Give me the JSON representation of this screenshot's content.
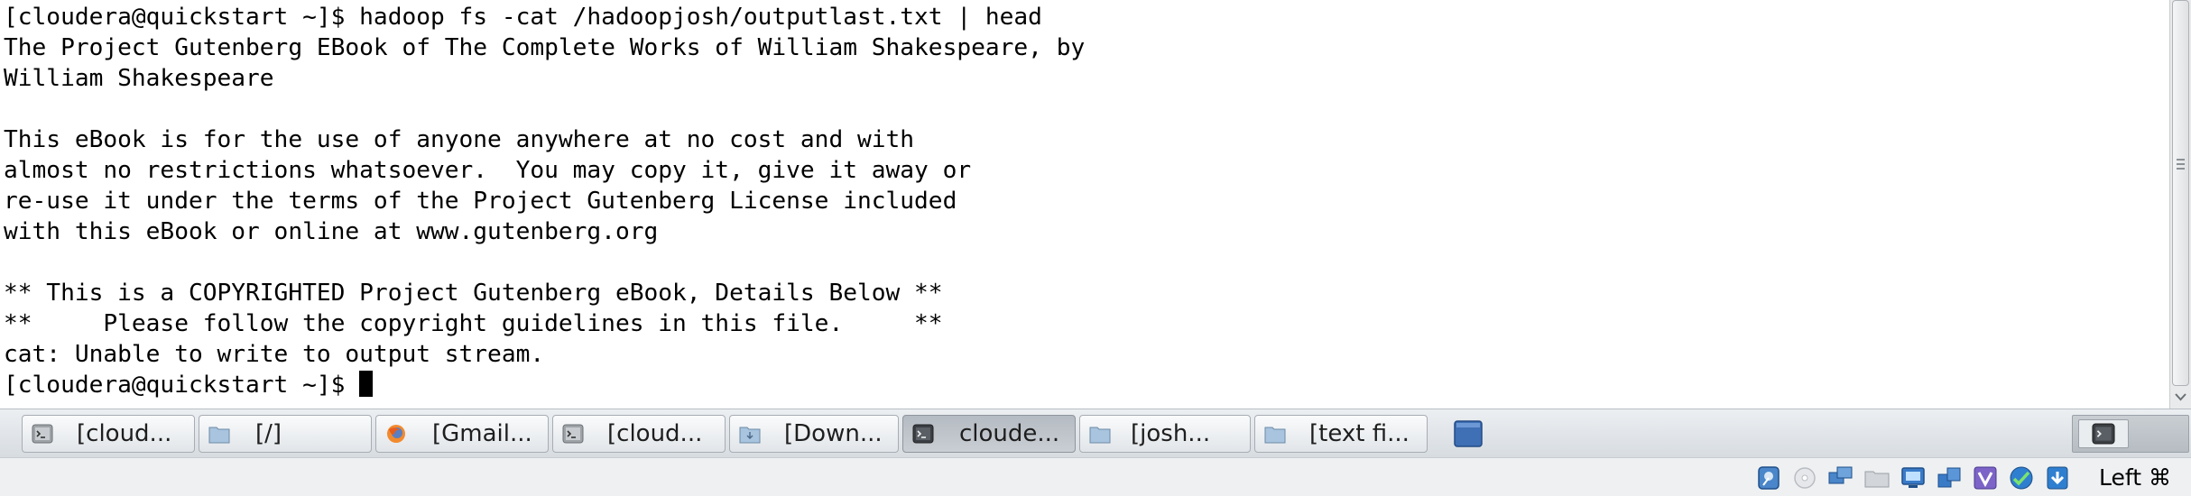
{
  "terminal": {
    "lines": [
      "[cloudera@quickstart ~]$ hadoop fs -cat /hadoopjosh/outputlast.txt | head",
      "The Project Gutenberg EBook of The Complete Works of William Shakespeare, by",
      "William Shakespeare",
      "",
      "This eBook is for the use of anyone anywhere at no cost and with",
      "almost no restrictions whatsoever.  You may copy it, give it away or",
      "re-use it under the terms of the Project Gutenberg License included",
      "with this eBook or online at www.gutenberg.org",
      "",
      "** This is a COPYRIGHTED Project Gutenberg eBook, Details Below **",
      "**     Please follow the copyright guidelines in this file.     **",
      "cat: Unable to write to output stream."
    ],
    "prompt": "[cloudera@quickstart ~]$ "
  },
  "taskbar": {
    "tasks": [
      {
        "label": "[cloud...",
        "icon": "terminal-icon",
        "active": false
      },
      {
        "label": "[/]",
        "icon": "folder-icon",
        "active": false
      },
      {
        "label": "[Gmail...",
        "icon": "firefox-icon",
        "active": false
      },
      {
        "label": "[cloud...",
        "icon": "terminal-icon",
        "active": false
      },
      {
        "label": "[Down...",
        "icon": "download-folder-icon",
        "active": false
      },
      {
        "label": "cloude...",
        "icon": "terminal-icon",
        "active": true
      },
      {
        "label": "[josh...",
        "icon": "folder-icon",
        "active": false
      },
      {
        "label": "[text fi...",
        "icon": "folder-icon",
        "active": false
      }
    ]
  },
  "statusbar": {
    "host_key": "Left ⌘"
  }
}
